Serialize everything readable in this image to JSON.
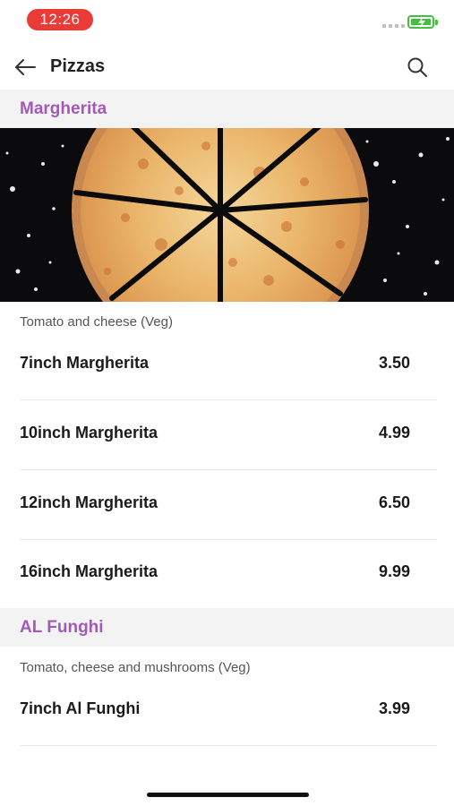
{
  "status_bar": {
    "time": "12:26"
  },
  "header": {
    "title": "Pizzas"
  },
  "sections": [
    {
      "title": "Margherita",
      "description": "Tomato and cheese (Veg)",
      "items": [
        {
          "name": "7inch Margherita",
          "price": "3.50"
        },
        {
          "name": "10inch Margherita",
          "price": "4.99"
        },
        {
          "name": "12inch Margherita",
          "price": "6.50"
        },
        {
          "name": "16inch Margherita",
          "price": "9.99"
        }
      ]
    },
    {
      "title": "AL Funghi",
      "description": "Tomato, cheese and mushrooms (Veg)",
      "items": [
        {
          "name": "7inch Al Funghi",
          "price": "3.99"
        }
      ]
    }
  ],
  "colors": {
    "accent": "#a35ab7",
    "time_pill": "#ea3b37",
    "battery": "#3fc03f"
  }
}
